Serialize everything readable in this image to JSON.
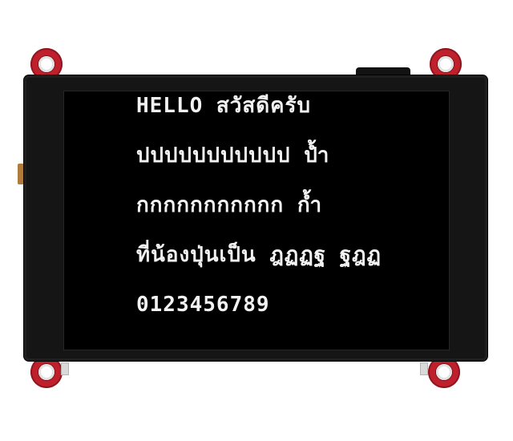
{
  "display": {
    "lines": [
      "HELLO สวัสดีครับ",
      "ปปปปปปปปปปป ป้ำ",
      "กกกกกกกกกกก ก้ำ",
      "ที่น้องปุ่นเป็น ฎฏฏฐ ฐฎฏ",
      "0123456789"
    ]
  },
  "colors": {
    "screen_background": "#000000",
    "text": "#f2f2f2",
    "bezel": "#151515",
    "mounting_ears": "#c0202c"
  }
}
